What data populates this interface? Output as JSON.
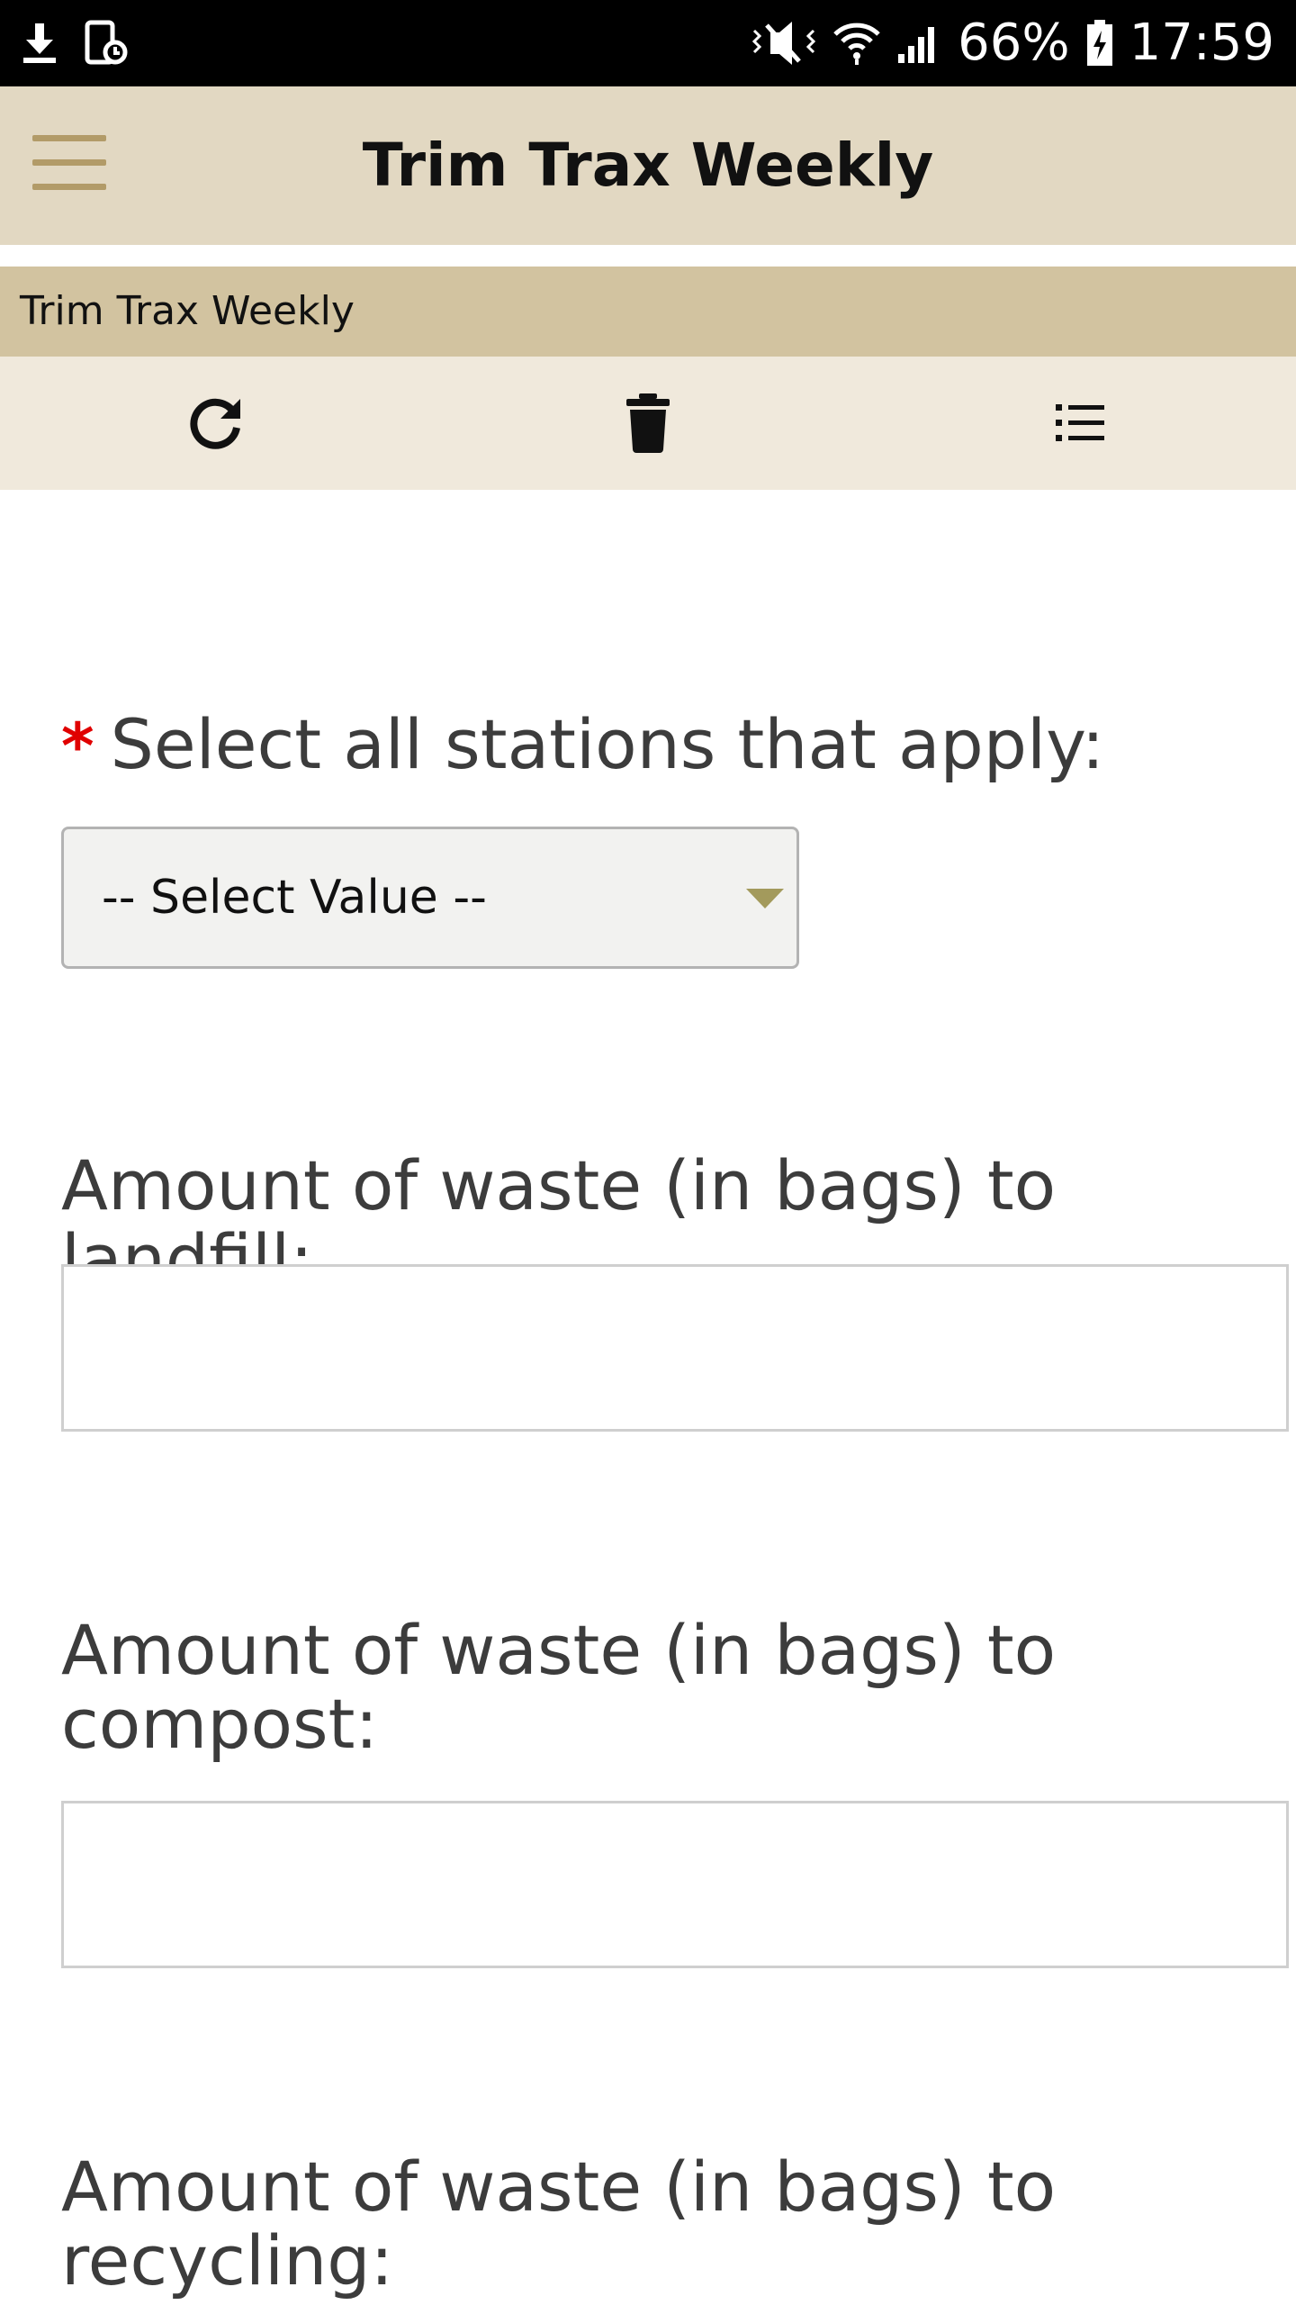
{
  "status_bar": {
    "battery": "66%",
    "time": "17:59",
    "icons": [
      "download-icon",
      "screenshot-icon",
      "mute-icon",
      "wifi-icon",
      "signal-icon",
      "battery-charging-icon"
    ]
  },
  "app_bar": {
    "title": "Trim Trax Weekly",
    "menu_icon": "hamburger-menu-icon"
  },
  "form": {
    "header_title": "Trim Trax Weekly",
    "toolbar": {
      "refresh_icon": "refresh-icon",
      "delete_icon": "trash-icon",
      "list_icon": "list-icon"
    },
    "required_marker": "*",
    "stations_label": "Select all stations that apply:",
    "stations_select_value": "-- Select Value --",
    "landfill_label": "Amount of waste (in bags) to landfill:",
    "landfill_value": "",
    "compost_label": "Amount of waste (in bags) to compost:",
    "compost_value": "",
    "recycling_label": "Amount of waste (in bags) to recycling:"
  },
  "colors": {
    "status_bar_bg": "#000000",
    "app_bar_bg": "#e2d8c2",
    "form_header_bg": "#d2c3a0",
    "toolbar_bg": "#f0e9dc",
    "accent_gold": "#b29b68",
    "required_red": "#e00000"
  }
}
